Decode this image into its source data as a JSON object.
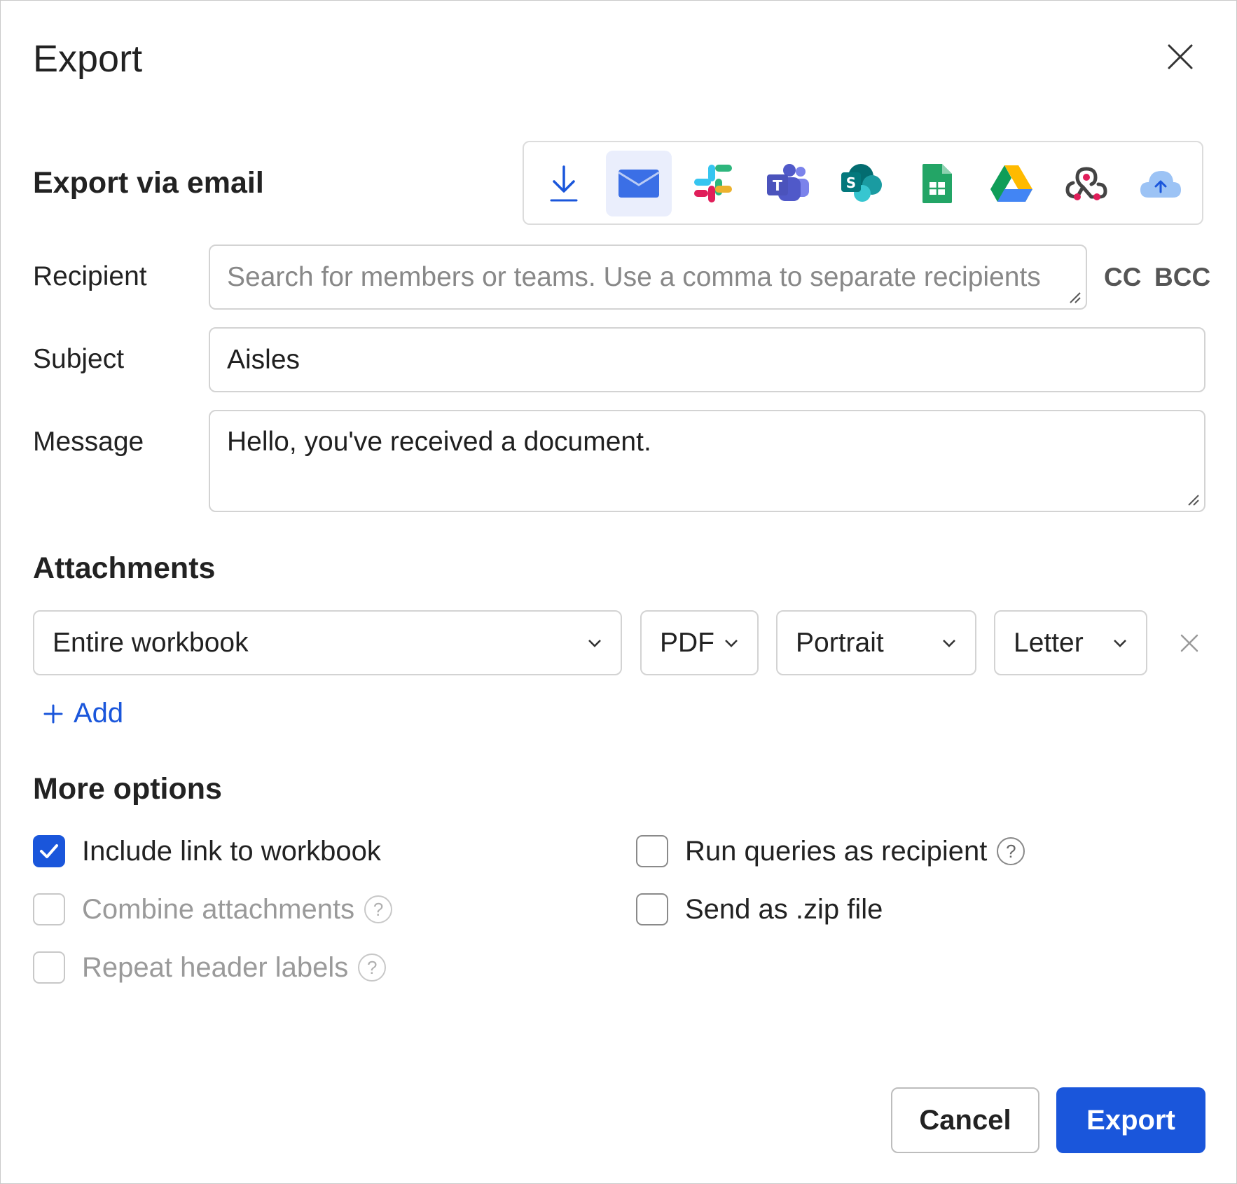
{
  "dialog": {
    "title": "Export"
  },
  "section": {
    "title": "Export via email"
  },
  "destinations": [
    {
      "name": "download",
      "active": false
    },
    {
      "name": "email",
      "active": true
    },
    {
      "name": "slack",
      "active": false
    },
    {
      "name": "microsoft-teams",
      "active": false
    },
    {
      "name": "sharepoint",
      "active": false
    },
    {
      "name": "google-sheets",
      "active": false
    },
    {
      "name": "google-drive",
      "active": false
    },
    {
      "name": "webhook",
      "active": false
    },
    {
      "name": "cloud-upload",
      "active": false
    }
  ],
  "form": {
    "recipient_label": "Recipient",
    "recipient_placeholder": "Search for members or teams. Use a comma to separate recipients",
    "cc_label": "CC",
    "bcc_label": "BCC",
    "subject_label": "Subject",
    "subject_value": "Aisles",
    "message_label": "Message",
    "message_value": "Hello, you've received a document."
  },
  "attachments": {
    "title": "Attachments",
    "scope": "Entire workbook",
    "format": "PDF",
    "orientation": "Portrait",
    "paper_size": "Letter",
    "add_label": "Add"
  },
  "more_options": {
    "title": "More options",
    "include_link": {
      "label": "Include link to workbook",
      "checked": true
    },
    "combine": {
      "label": "Combine attachments",
      "checked": false,
      "disabled": true
    },
    "repeat_headers": {
      "label": "Repeat header labels",
      "checked": false,
      "disabled": true
    },
    "run_queries": {
      "label": "Run queries as recipient",
      "checked": false
    },
    "send_zip": {
      "label": "Send as .zip file",
      "checked": false
    },
    "help_glyph": "?"
  },
  "footer": {
    "cancel_label": "Cancel",
    "export_label": "Export"
  },
  "colors": {
    "accent": "#1a56db",
    "active_tab_bg": "#eaeefc",
    "border": "#d3d3d3"
  }
}
